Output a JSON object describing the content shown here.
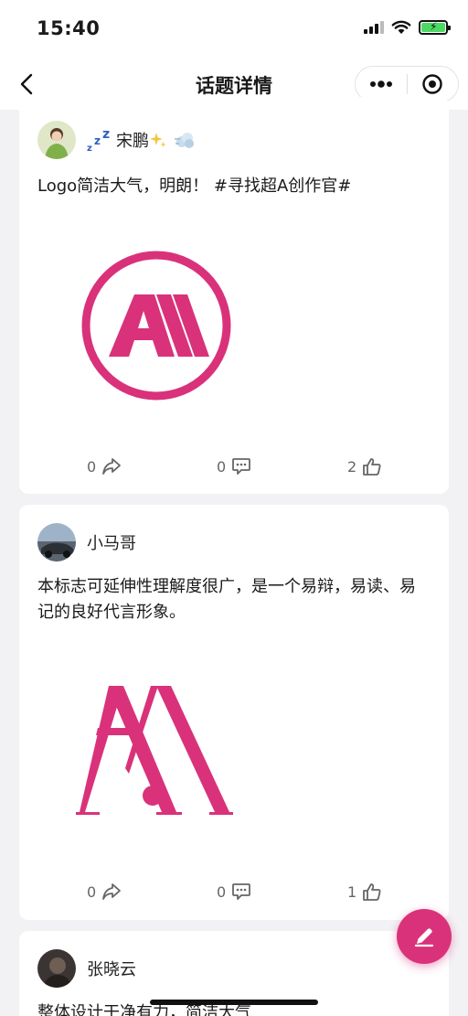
{
  "status_bar": {
    "time": "15:40"
  },
  "nav": {
    "title": "话题详情"
  },
  "colors": {
    "brand": "#d9327a",
    "background": "#f2f2f4",
    "card": "#ffffff"
  },
  "posts": [
    {
      "author": "宋鹏",
      "author_prefix_icon": "zzz-sleep-icon",
      "author_suffix_icons": [
        "sparkles-icon",
        "wind-puff-icon"
      ],
      "text": "Logo简洁大气，明朗！ #寻找超A创作官#",
      "image": "circle-a-logo",
      "share_count": "0",
      "comment_count": "0",
      "like_count": "2"
    },
    {
      "author": "小马哥",
      "text": "本标志可延伸性理解度很广，是一个易辩，易读、易记的良好代言形象。",
      "image": "serif-a-logo",
      "share_count": "0",
      "comment_count": "0",
      "like_count": "1"
    },
    {
      "author": "张晓云",
      "text": "整体设计干净有力，简洁大气"
    }
  ]
}
